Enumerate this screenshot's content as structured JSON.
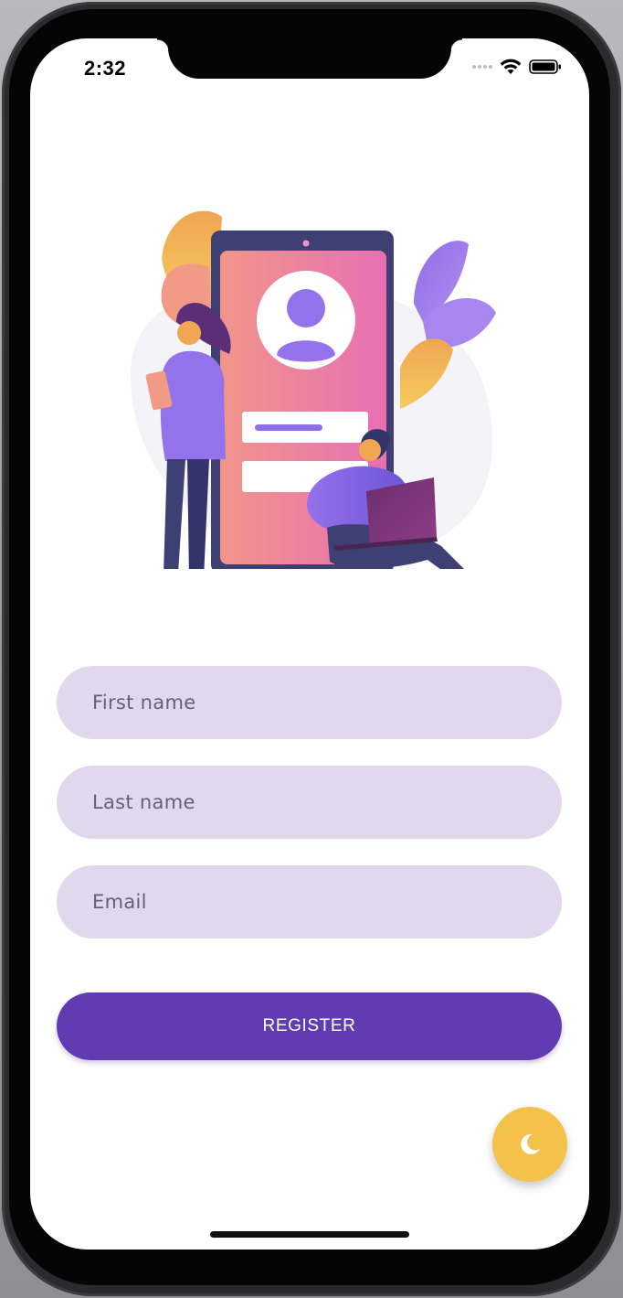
{
  "status_bar": {
    "time": "2:32"
  },
  "form": {
    "first_name_placeholder": "First name",
    "last_name_placeholder": "Last name",
    "email_placeholder": "Email",
    "register_label": "REGISTER"
  },
  "fab": {
    "icon": "moon-icon",
    "color": "#f4c14a"
  },
  "colors": {
    "accent": "#613bb2",
    "field_background": "#e1d8ee",
    "placeholder_text": "#6b5b7d"
  }
}
